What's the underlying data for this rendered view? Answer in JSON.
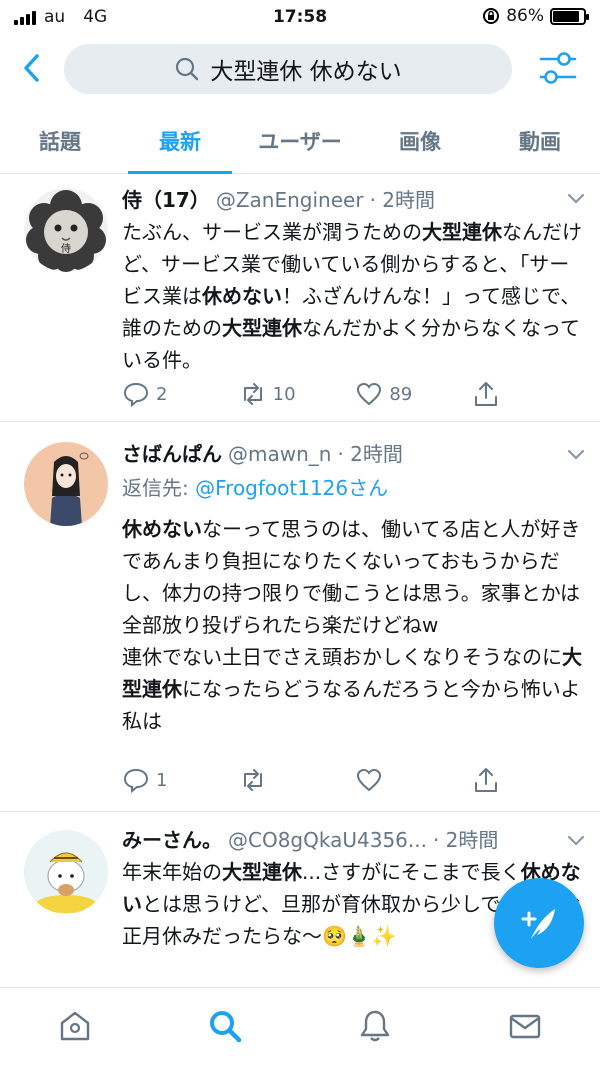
{
  "status_bar": {
    "carrier": "au",
    "network": "4G",
    "time": "17:58",
    "battery_text": "86%",
    "battery_level": 0.86
  },
  "search": {
    "query": "大型連休 休めない"
  },
  "tabs": [
    {
      "label": "話題",
      "active": false
    },
    {
      "label": "最新",
      "active": true
    },
    {
      "label": "ユーザー",
      "active": false
    },
    {
      "label": "画像",
      "active": false
    },
    {
      "label": "動画",
      "active": false
    }
  ],
  "tweets": [
    {
      "name": "侍（17）",
      "handle": "@ZanEngineer",
      "time": "· 2時間",
      "avatar_text": "侍",
      "text": "たぶん、サービス業が潤うための大型連休なんだけど、サービス業で働いている側からすると、「サービス業は休めない！ふざんけんな！」って感じで、誰のための大型連休なんだかよく分からなくなっている件。",
      "replies": "2",
      "retweets": "10",
      "likes": "89"
    },
    {
      "name": "さばんぱん",
      "handle": "@mawn_n",
      "time": "· 2時間",
      "reply_label": "返信先:",
      "reply_mention": "@Frogfoot1126さん",
      "text": "休めないなーって思うのは、働いてる店と人が好きであんまり負担になりたくないっておもうからだし、体力の持つ限りで働こうとは思う。家事とかは全部放り投げられたら楽だけどねw\n連休でない土日でさえ頭おかしくなりそうなのに大型連休になったらどうなるんだろうと今から怖いよ私は",
      "replies": "1",
      "retweets": "",
      "likes": ""
    },
    {
      "name": "みーさん。",
      "handle": "@CO8gQkaU4356...",
      "time": "· 2時間",
      "text": "年末年始の大型連休...さすがにそこまで長く休めないとは思うけど、旦那が育休取から少しでも長いお正月休みだったらな〜🥺🎍✨",
      "replies": "",
      "retweets": "",
      "likes": ""
    }
  ],
  "icons": {
    "back": "chevron-left-icon",
    "search": "search-icon",
    "filter": "sliders-icon",
    "reply": "reply-icon",
    "retweet": "retweet-icon",
    "like": "heart-icon",
    "share": "share-icon",
    "compose": "compose-icon",
    "home": "home-icon",
    "explore": "search-icon",
    "notifications": "bell-icon",
    "messages": "mail-icon"
  },
  "colors": {
    "accent": "#1da1f2",
    "muted": "#657786",
    "text": "#14171a",
    "search_bg": "#e6ecf0"
  }
}
